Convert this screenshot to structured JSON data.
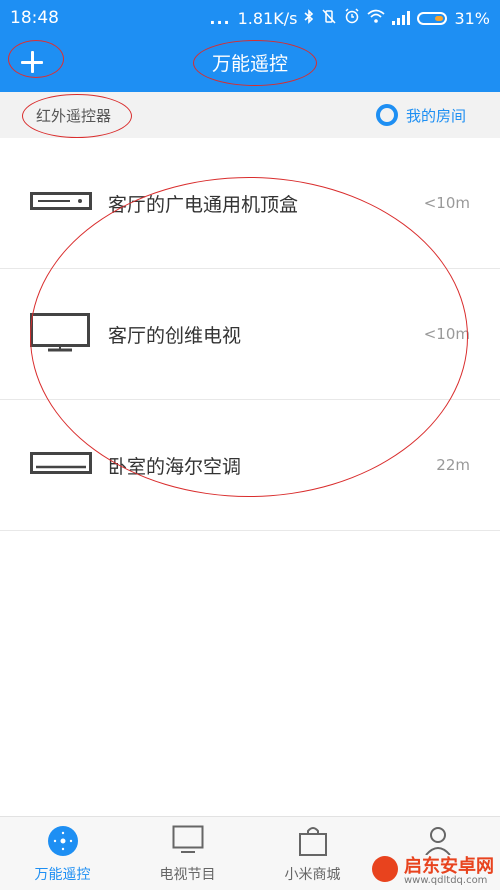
{
  "status_bar": {
    "time": "18:48",
    "dots": "...",
    "network_speed": "1.81K/s",
    "battery": "31%",
    "icons": [
      "bluetooth-icon",
      "vibrate-off-icon",
      "alarm-icon",
      "wifi-icon",
      "signal-icon",
      "battery-icon"
    ]
  },
  "header": {
    "title": "万能遥控",
    "add_icon": "plus-icon"
  },
  "subheader": {
    "label": "红外遥控器",
    "room_link": "我的房间"
  },
  "devices": [
    {
      "name": "客厅的广电通用机顶盒",
      "distance": "<10m",
      "icon": "set-top-box-icon"
    },
    {
      "name": "客厅的创维电视",
      "distance": "<10m",
      "icon": "tv-icon"
    },
    {
      "name": "卧室的海尔空调",
      "distance": "22m",
      "icon": "air-conditioner-icon"
    }
  ],
  "tabs": [
    {
      "label": "万能遥控",
      "icon": "remote-icon",
      "active": true
    },
    {
      "label": "电视节目",
      "icon": "tv-icon",
      "active": false
    },
    {
      "label": "小米商城",
      "icon": "shopping-bag-icon",
      "active": false
    },
    {
      "label": "",
      "icon": "profile-icon",
      "active": false
    }
  ],
  "watermark": {
    "title": "启东安卓网",
    "url": "www.qdltdq.com"
  },
  "colors": {
    "accent": "#1e8ff3",
    "annotation": "#d92d2d"
  }
}
